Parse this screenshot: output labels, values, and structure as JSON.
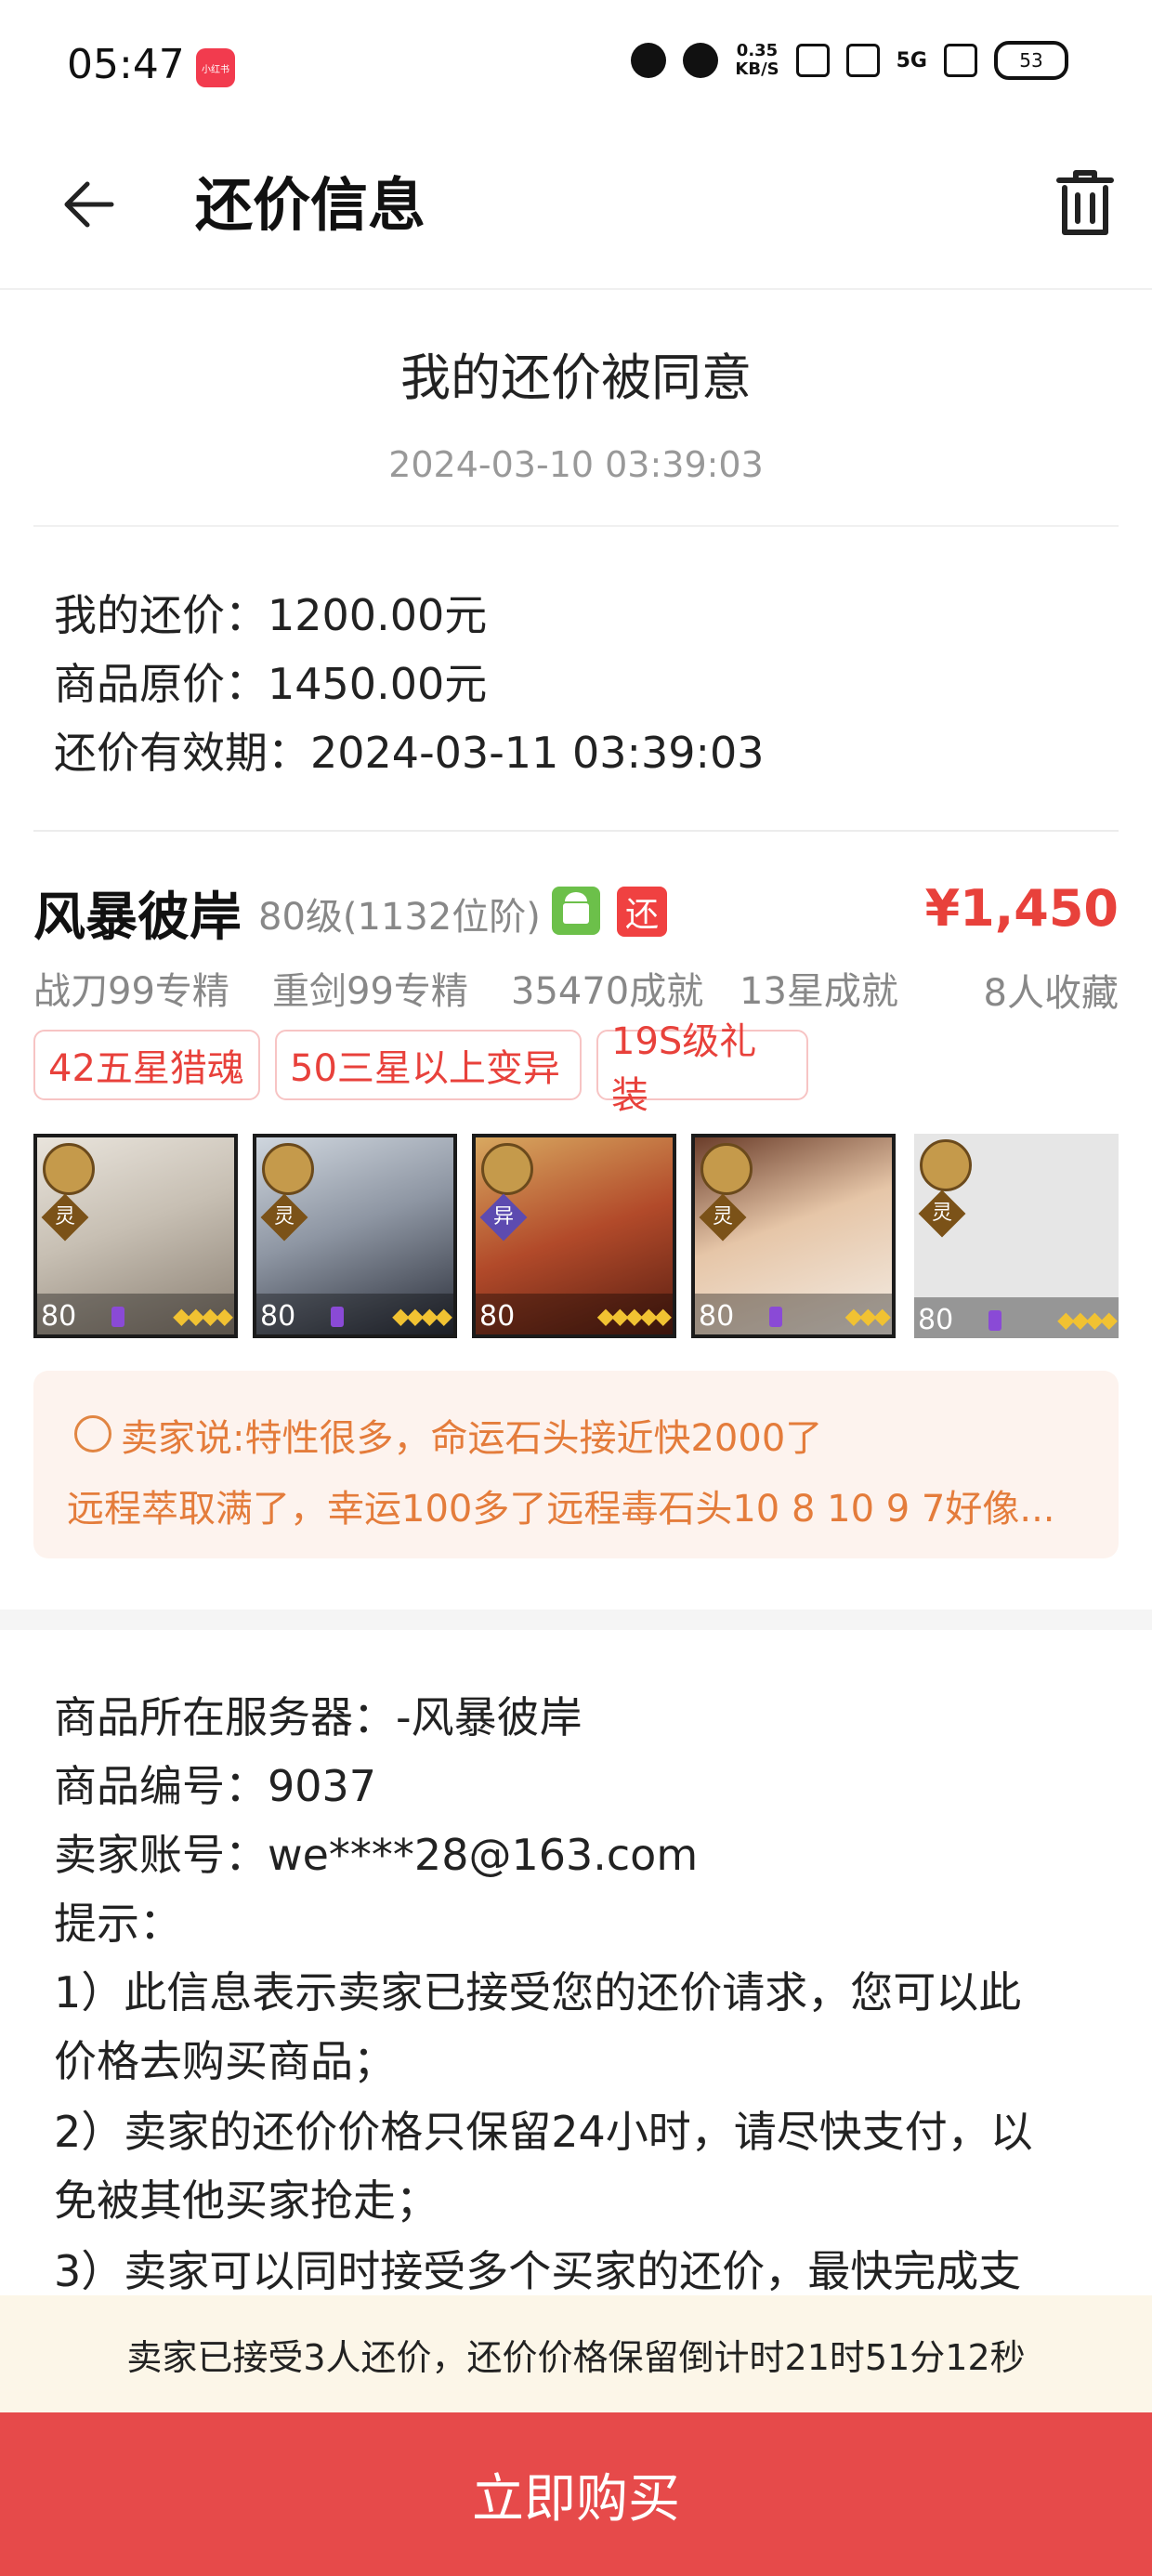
{
  "status_bar": {
    "time": "05:47",
    "app_badge": "小红书",
    "net_speed_value": "0.35",
    "net_speed_unit": "KB/S",
    "net_type": "5G",
    "battery": "53"
  },
  "nav": {
    "title": "还价信息"
  },
  "offer": {
    "title": "我的还价被同意",
    "time": "2024-03-10 03:39:03",
    "my_offer": "我的还价：1200.00元",
    "original_price": "商品原价：1450.00元",
    "valid_until": "还价有效期：2024-03-11 03:39:03"
  },
  "product": {
    "name": "风暴彼岸",
    "level": "80级(1132位阶)",
    "badge_huan": "还",
    "price": "¥1,450",
    "tags": [
      "战刀99专精",
      "重剑99专精",
      "35470成就",
      "13星成就"
    ],
    "favorites": "8人收藏",
    "chips": [
      "42五星猎魂",
      "50三星以上变异",
      "19S级礼装"
    ],
    "heroes": [
      {
        "level": "80",
        "kind": "灵",
        "stars": "◆◆◆◆"
      },
      {
        "level": "80",
        "kind": "灵",
        "stars": "◆◆◆◆"
      },
      {
        "level": "80",
        "kind": "异",
        "stars": "◆◆◆◆◆"
      },
      {
        "level": "80",
        "kind": "灵",
        "stars": "◆◆◆"
      },
      {
        "level": "80",
        "kind": "灵",
        "stars": "◆◆◆◆"
      }
    ]
  },
  "seller_note": {
    "line1": "卖家说:特性很多，命运石头接近快2000了",
    "line2": "远程萃取满了，幸运100多了远程毒石头10 8  10 9 7好像..."
  },
  "details": {
    "server": "商品所在服务器：-风暴彼岸",
    "item_no": "商品编号：9037",
    "seller_account": "卖家账号：we****28@163.com",
    "tip_title": "提示：",
    "tip1_a": "1）此信息表示卖家已接受您的还价请求，您可以此",
    "tip1_b": "价格去购买商品；",
    "tip2_a": "2）卖家的还价价格只保留24小时，请尽快支付，以",
    "tip2_b": "免被其他买家抢走；",
    "tip3_a": "3）卖家可以同时接受多个买家的还价，最快完成支"
  },
  "countdown": "卖家已接受3人还价，还价价格保留倒计时21时51分12秒",
  "buy_button": "立即购买",
  "colors": {
    "accent": "#e64a4a",
    "price": "#e8413b",
    "note_text": "#e47c3b"
  }
}
